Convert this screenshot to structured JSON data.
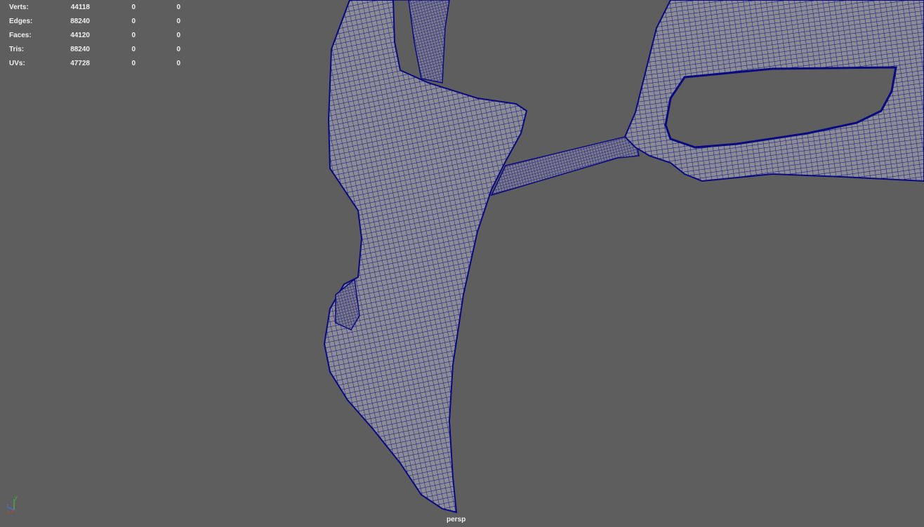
{
  "hud": {
    "rows": [
      {
        "label": "Verts:",
        "c1": "44118",
        "c2": "0",
        "c3": "0"
      },
      {
        "label": "Edges:",
        "c1": "88240",
        "c2": "0",
        "c3": "0"
      },
      {
        "label": "Faces:",
        "c1": "44120",
        "c2": "0",
        "c3": "0"
      },
      {
        "label": "Tris:",
        "c1": "88240",
        "c2": "0",
        "c3": "0"
      },
      {
        "label": "UVs:",
        "c1": "47728",
        "c2": "0",
        "c3": "0"
      }
    ]
  },
  "viewport": {
    "camera": "persp",
    "background_color": "#5e5e5e",
    "wire_color": "#0a0a80",
    "surface_color": "#8a8a92"
  },
  "axis_gizmo": {
    "y_label": "y",
    "z_label": "z",
    "x_label": "x"
  }
}
